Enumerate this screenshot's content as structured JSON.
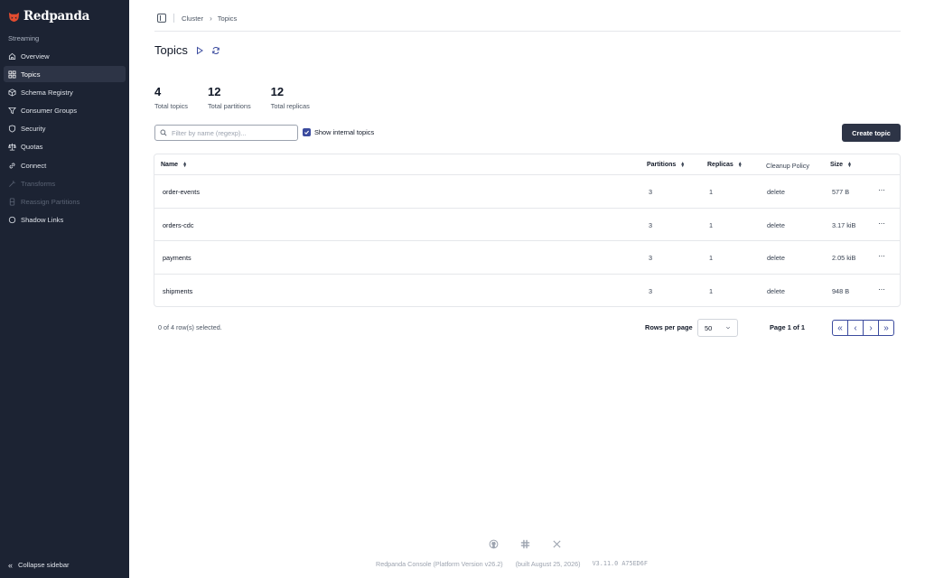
{
  "app": {
    "brand": "Redpanda",
    "accent": "#3b4b9e",
    "sidebar_bg": "#1c2333"
  },
  "sidebar": {
    "section_label": "Streaming",
    "items": [
      {
        "label": "Overview",
        "icon": "home-icon"
      },
      {
        "label": "Topics",
        "icon": "grid-icon",
        "active": true
      },
      {
        "label": "Schema Registry",
        "icon": "box-icon"
      },
      {
        "label": "Consumer Groups",
        "icon": "funnel-icon"
      },
      {
        "label": "Security",
        "icon": "shield-icon"
      },
      {
        "label": "Quotas",
        "icon": "scale-icon"
      },
      {
        "label": "Connect",
        "icon": "link-icon"
      },
      {
        "label": "Transforms",
        "icon": "wand-icon",
        "disabled": true
      },
      {
        "label": "Reassign Partitions",
        "icon": "server-icon",
        "disabled": true
      },
      {
        "label": "Shadow Links",
        "icon": "circle-icon"
      }
    ],
    "collapse_label": "Collapse sidebar"
  },
  "breadcrumb": {
    "items": [
      "Cluster",
      "Topics"
    ]
  },
  "page": {
    "title": "Topics"
  },
  "stats": [
    {
      "value": "4",
      "label": "Total topics"
    },
    {
      "value": "12",
      "label": "Total partitions"
    },
    {
      "value": "12",
      "label": "Total replicas"
    }
  ],
  "toolbar": {
    "filter_placeholder": "Filter by name (regexp)...",
    "show_internal_label": "Show internal topics",
    "show_internal_checked": true,
    "create_label": "Create topic"
  },
  "table": {
    "columns": {
      "name": "Name",
      "partitions": "Partitions",
      "replicas": "Replicas",
      "cleanup": "Cleanup Policy",
      "size": "Size"
    },
    "rows": [
      {
        "name": "order-events",
        "partitions": "3",
        "replicas": "1",
        "cleanup": "delete",
        "size": "577 B"
      },
      {
        "name": "orders-cdc",
        "partitions": "3",
        "replicas": "1",
        "cleanup": "delete",
        "size": "3.17 kiB"
      },
      {
        "name": "payments",
        "partitions": "3",
        "replicas": "1",
        "cleanup": "delete",
        "size": "2.05 kiB"
      },
      {
        "name": "shipments",
        "partitions": "3",
        "replicas": "1",
        "cleanup": "delete",
        "size": "948 B"
      }
    ],
    "row_action": "···"
  },
  "pagination": {
    "selected_info": "0 of 4 row(s) selected.",
    "rows_per_page_label": "Rows per page",
    "rows_per_page_value": "50",
    "page_info": "Page 1 of 1",
    "first": "«",
    "prev": "‹",
    "next": "›",
    "last": "»"
  },
  "footer": {
    "product": "Redpanda Console (Platform Version v26.2)",
    "built": "(built August 25, 2026)",
    "version": "V3.11.0 A75ED6F"
  }
}
